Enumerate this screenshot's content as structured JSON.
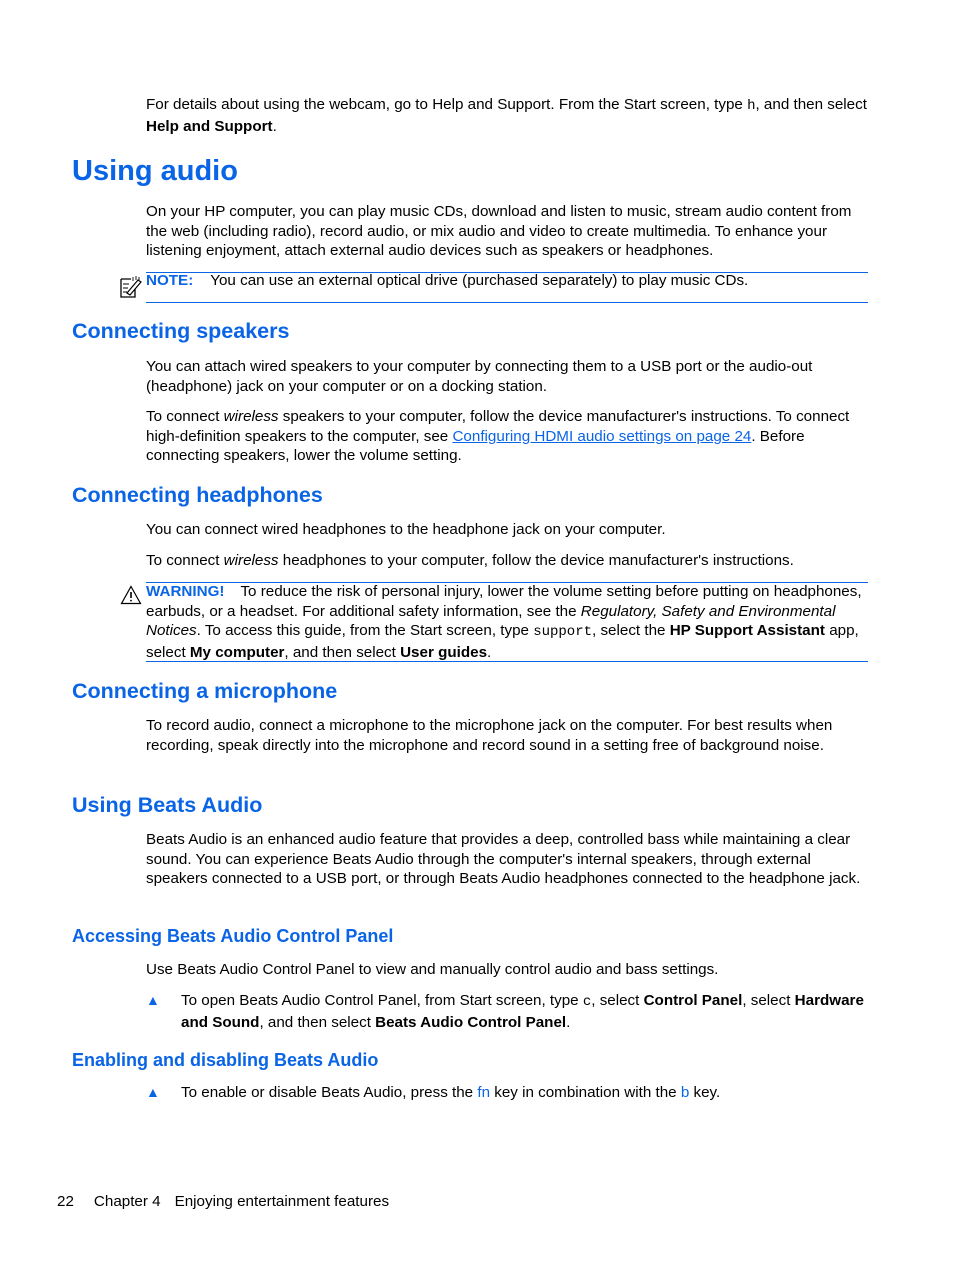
{
  "intro": {
    "part1": "For details about using the webcam, go to Help and Support. From the Start screen, type ",
    "code": "h",
    "part2": ", and then select ",
    "bold": "Help and Support",
    "part3": "."
  },
  "sections": {
    "using_audio": {
      "title": "Using audio",
      "para": "On your HP computer, you can play music CDs, download and listen to music, stream audio content from the web (including radio), record audio, or mix audio and video to create multimedia. To enhance your listening enjoyment, attach external audio devices such as speakers or headphones.",
      "note": {
        "icon": "note-pencil-icon",
        "label": "NOTE:",
        "text": "You can use an external optical drive (purchased separately) to play music CDs."
      }
    },
    "speakers": {
      "title": "Connecting speakers",
      "para1": "You can attach wired speakers to your computer by connecting them to a USB port or the audio-out (headphone) jack on your computer or on a docking station.",
      "para2_a": "To connect ",
      "para2_italic": "wireless",
      "para2_b": " speakers to your computer, follow the device manufacturer's instructions. To connect high-definition speakers to the computer, see ",
      "para2_link": "Configuring HDMI audio settings on page 24",
      "para2_c": ". Before connecting speakers, lower the volume setting."
    },
    "headphones": {
      "title": "Connecting headphones",
      "para1": "You can connect wired headphones to the headphone jack on your computer.",
      "para2_a": "To connect ",
      "para2_italic": "wireless",
      "para2_b": " headphones to your computer, follow the device manufacturer's instructions.",
      "warning": {
        "icon": "warning-triangle-icon",
        "label": "WARNING!",
        "t1": "To reduce the risk of personal injury, lower the volume setting before putting on headphones, earbuds, or a headset. For additional safety information, see the ",
        "italic": "Regulatory, Safety and Environmental Notices",
        "t2": ". To access this guide, from the Start screen, type ",
        "code": "support",
        "t3": ", select the ",
        "bold1": "HP Support Assistant",
        "t4": " app, select ",
        "bold2": "My computer",
        "t5": ", and then select ",
        "bold3": "User guides",
        "t6": "."
      }
    },
    "microphone": {
      "title": "Connecting a microphone",
      "para": "To record audio, connect a microphone to the microphone jack on the computer. For best results when recording, speak directly into the microphone and record sound in a setting free of background noise."
    },
    "beats": {
      "title": "Using Beats Audio",
      "para": "Beats Audio is an enhanced audio feature that provides a deep, controlled bass while maintaining a clear sound. You can experience Beats Audio through the computer's internal speakers, through external speakers connected to a USB port, or through Beats Audio headphones connected to the headphone jack."
    },
    "control_panel": {
      "title": "Accessing Beats Audio Control Panel",
      "para": "Use Beats Audio Control Panel to view and manually control audio and bass settings.",
      "bullet": "▲",
      "step_a": "To open Beats Audio Control Panel, from Start screen, type ",
      "step_code": "c",
      "step_b": ", select ",
      "step_bold1": "Control Panel",
      "step_c": ", select ",
      "step_bold2": "Hardware and Sound",
      "step_d": ", and then select ",
      "step_bold3": "Beats Audio Control Panel",
      "step_e": "."
    },
    "enable": {
      "title": "Enabling and disabling Beats Audio",
      "bullet": "▲",
      "step_a": "To enable or disable Beats Audio, press the ",
      "key1": "fn",
      "step_b": " key in combination with the ",
      "key2": "b",
      "step_c": " key."
    }
  },
  "footer": {
    "page_number": "22",
    "chapter": "Chapter 4",
    "chapter_title": "Enjoying entertainment features"
  }
}
